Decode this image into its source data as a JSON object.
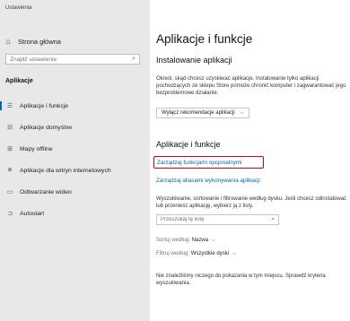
{
  "window": {
    "title": "Ustawienia"
  },
  "sidebar": {
    "home_label": "Strona główna",
    "search_placeholder": "Znajdź ustawienie",
    "section_label": "Aplikacje",
    "items": [
      {
        "label": "Aplikacje i funkcje",
        "icon": "list-icon",
        "active": true
      },
      {
        "label": "Aplikacje domyślne",
        "icon": "default-apps-icon",
        "active": false
      },
      {
        "label": "Mapy offline",
        "icon": "map-icon",
        "active": false
      },
      {
        "label": "Aplikacje dla witryn internetowych",
        "icon": "web-apps-icon",
        "active": false
      },
      {
        "label": "Odtwarzanie wideo",
        "icon": "video-icon",
        "active": false
      },
      {
        "label": "Autostart",
        "icon": "startup-icon",
        "active": false
      }
    ]
  },
  "main": {
    "title": "Aplikacje i funkcje",
    "install_heading": "Instalowanie aplikacji",
    "install_description": "Określ, skąd chcesz uzyskiwać aplikacje. Instalowanie tylko aplikacji pochodzących ze sklepu Store pomoże chronić komputer i zagwarantować jego bezproblemowe działanie.",
    "install_dropdown_value": "Wyłącz rekomendacje aplikacji",
    "apps_heading": "Aplikacje i funkcje",
    "optional_features_link": "Zarządzaj funkcjami opcjonalnymi",
    "aliases_link": "Zarządzaj aliasami wykonywania aplikacji",
    "apps_description": "Wyszukiwanie, sortowanie i filtrowanie według dysku. Jeśli chcesz odinstalować lub przenieść aplikację, wybierz ją z listy.",
    "list_search_placeholder": "Przeszukaj tę listę",
    "sort_label": "Sortuj według:",
    "sort_value": "Nazwa",
    "filter_label": "Filtruj według:",
    "filter_value": "Wszystkie dyski",
    "empty_message": "Nie znaleźliśmy niczego do pokazania w tym miejscu. Sprawdź kryteria wyszukiwania."
  },
  "colors": {
    "accent": "#0067b8",
    "highlight_box": "#d0021b",
    "sidebar_bg": "#e8e8e8"
  }
}
